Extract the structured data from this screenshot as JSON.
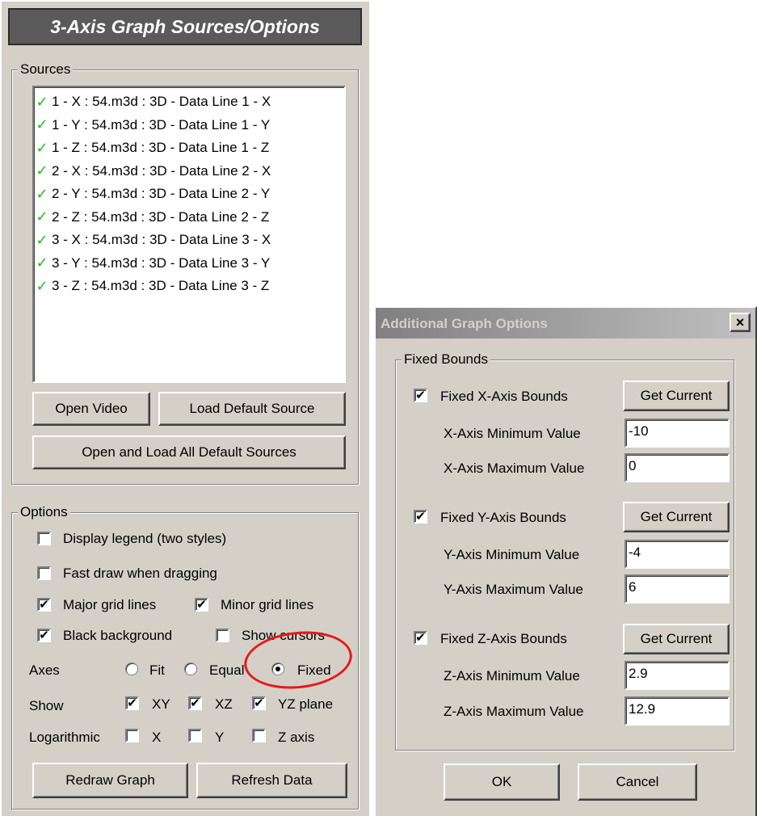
{
  "left_panel": {
    "title": "3-Axis Graph Sources/Options",
    "sources": {
      "legend": "Sources",
      "items": [
        "1 - X : 54.m3d : 3D - Data Line 1 - X",
        "1 - Y : 54.m3d : 3D - Data Line 1 - Y",
        "1 - Z : 54.m3d : 3D - Data Line 1 - Z",
        "2 - X : 54.m3d : 3D - Data Line 2 - X",
        "2 - Y : 54.m3d : 3D - Data Line 2 - Y",
        "2 - Z : 54.m3d : 3D - Data Line 2 - Z",
        "3 - X : 54.m3d : 3D - Data Line 3 - X",
        "3 - Y : 54.m3d : 3D - Data Line 3 - Y",
        "3 - Z : 54.m3d : 3D - Data Line 3 - Z"
      ],
      "item_icon": "green-check-icon",
      "buttons": {
        "open_video": "Open Video",
        "load_default": "Load Default Source",
        "open_load_all": "Open and Load All Default Sources"
      }
    },
    "options": {
      "legend": "Options",
      "display_legend": {
        "label": "Display legend (two styles)",
        "checked": false
      },
      "fast_draw": {
        "label": "Fast draw when dragging",
        "checked": false
      },
      "major_grid": {
        "label": "Major grid lines",
        "checked": true
      },
      "minor_grid": {
        "label": "Minor grid lines",
        "checked": true
      },
      "black_bg": {
        "label": "Black background",
        "checked": true
      },
      "show_cursors": {
        "label": "Show cursors",
        "checked": false
      },
      "axes": {
        "label": "Axes",
        "options": [
          "Fit",
          "Equal",
          "Fixed"
        ],
        "selected": "Fixed"
      },
      "show": {
        "label": "Show",
        "items": [
          {
            "label": "XY",
            "checked": true
          },
          {
            "label": "XZ",
            "checked": true
          },
          {
            "label": "YZ plane",
            "checked": true
          }
        ]
      },
      "logarithmic": {
        "label": "Logarithmic",
        "items": [
          {
            "label": "X",
            "checked": false
          },
          {
            "label": "Y",
            "checked": false
          },
          {
            "label": "Z axis",
            "checked": false
          }
        ]
      },
      "buttons": {
        "redraw": "Redraw Graph",
        "refresh": "Refresh Data"
      }
    }
  },
  "dialog": {
    "title": "Additional Graph Options",
    "close_glyph": "×",
    "group_label": "Fixed Bounds",
    "axes": [
      {
        "checkbox_label": "Fixed X-Axis Bounds",
        "checked": true,
        "button": "Get Current",
        "min_label": "X-Axis Minimum Value",
        "min_value": "-10",
        "max_label": "X-Axis Maximum Value",
        "max_value": "0"
      },
      {
        "checkbox_label": "Fixed Y-Axis Bounds",
        "checked": true,
        "button": "Get Current",
        "min_label": "Y-Axis Minimum Value",
        "min_value": "-4",
        "max_label": "Y-Axis Maximum Value",
        "max_value": "6"
      },
      {
        "checkbox_label": "Fixed Z-Axis Bounds",
        "checked": true,
        "button": "Get Current",
        "min_label": "Z-Axis Minimum Value",
        "min_value": "2.9",
        "max_label": "Z-Axis Maximum Value",
        "max_value": "12.9"
      }
    ],
    "ok": "OK",
    "cancel": "Cancel"
  },
  "colors": {
    "panel_bg": "#d4d0c8",
    "check_green": "#1bbf1b",
    "annotation_red": "#e81818",
    "title_bg": "#5a5a5a"
  }
}
